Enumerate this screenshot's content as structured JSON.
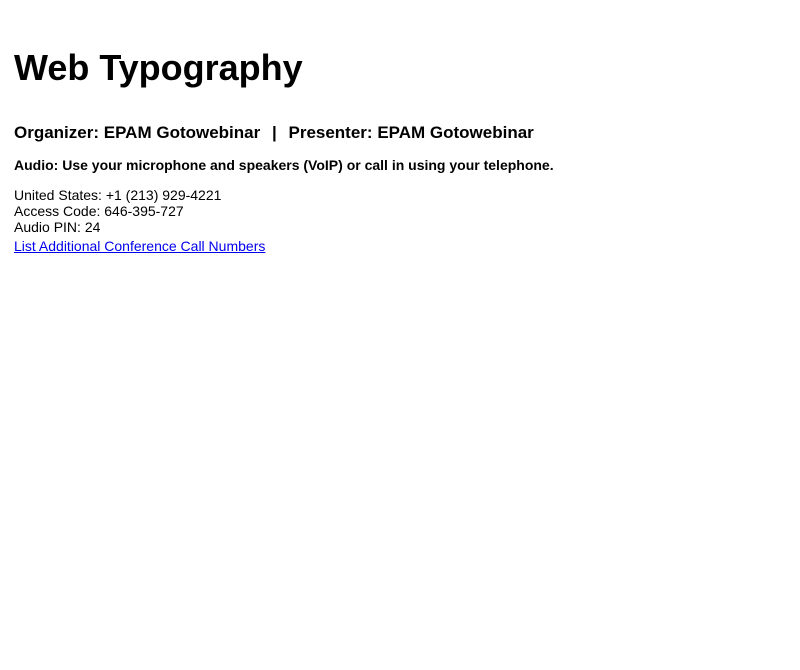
{
  "page": {
    "title": "Web Typography"
  },
  "people": {
    "organizer_label": "Organizer:",
    "organizer_name": "EPAM Gotowebinar",
    "separator": "|",
    "presenter_label": "Presenter:",
    "presenter_name": "EPAM Gotowebinar"
  },
  "audio": {
    "instructions": "Audio: Use your microphone and speakers (VoIP) or call in using your telephone."
  },
  "dial_in": {
    "rows": [
      "United States: +1 (213) 929-4221",
      "Access Code: 646-395-727",
      "Audio PIN: 24"
    ],
    "more_numbers_link": "List Additional Conference Call Numbers"
  },
  "colors": {
    "text": "#000000",
    "link": "#0000ee",
    "background": "#ffffff"
  }
}
